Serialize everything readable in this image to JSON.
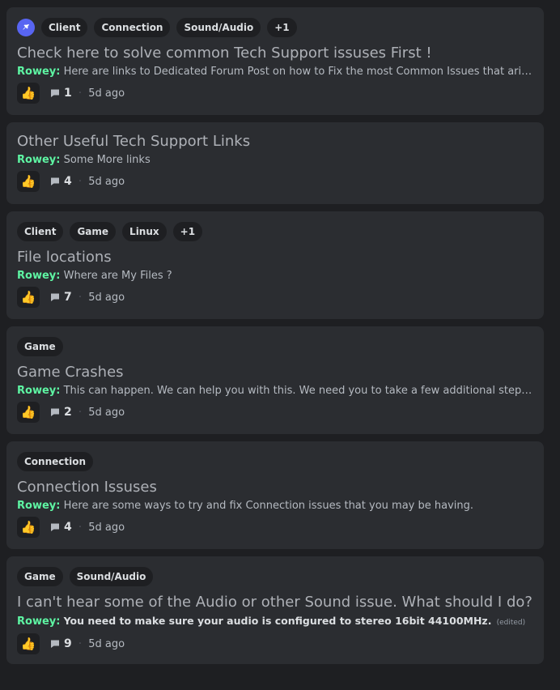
{
  "posts": [
    {
      "pinned": true,
      "tags": [
        "Client",
        "Connection",
        "Sound/Audio",
        "+1"
      ],
      "title": "Check here to solve common Tech Support issuses First !",
      "author": "Rowey:",
      "message": "Here are links to Dedicated Forum Post on how to Fix the most Common Issues that arise!",
      "reaction": "👍",
      "comments": "1",
      "age": "5d ago"
    },
    {
      "pinned": false,
      "tags": [],
      "title": "Other Useful Tech Support Links",
      "author": "Rowey:",
      "message": "Some More links",
      "reaction": "👍",
      "comments": "4",
      "age": "5d ago"
    },
    {
      "pinned": false,
      "tags": [
        "Client",
        "Game",
        "Linux",
        "+1"
      ],
      "title": "File locations",
      "author": "Rowey:",
      "message": "Where are My Files ?",
      "reaction": "👍",
      "comments": "7",
      "age": "5d ago"
    },
    {
      "pinned": false,
      "tags": [
        "Game"
      ],
      "title": "Game Crashes",
      "author": "Rowey:",
      "message": "This can happen. We can help you with this. We need you to take a few additional steps to get us ...",
      "reaction": "👍",
      "comments": "2",
      "age": "5d ago"
    },
    {
      "pinned": false,
      "tags": [
        "Connection"
      ],
      "title": "Connection Issuses",
      "author": "Rowey:",
      "message": "Here are some ways to try and fix Connection issues that you may be having.",
      "reaction": "👍",
      "comments": "4",
      "age": "5d ago"
    },
    {
      "pinned": false,
      "tags": [
        "Game",
        "Sound/Audio"
      ],
      "title": "I can't hear some of the Audio or other Sound issue. What should I do?",
      "author": "Rowey:",
      "message": "You need to make sure your audio is configured to stereo 16bit 44100MHz.",
      "bold_message": true,
      "edited": "(edited)",
      "reaction": "👍",
      "comments": "9",
      "age": "5d ago"
    }
  ]
}
